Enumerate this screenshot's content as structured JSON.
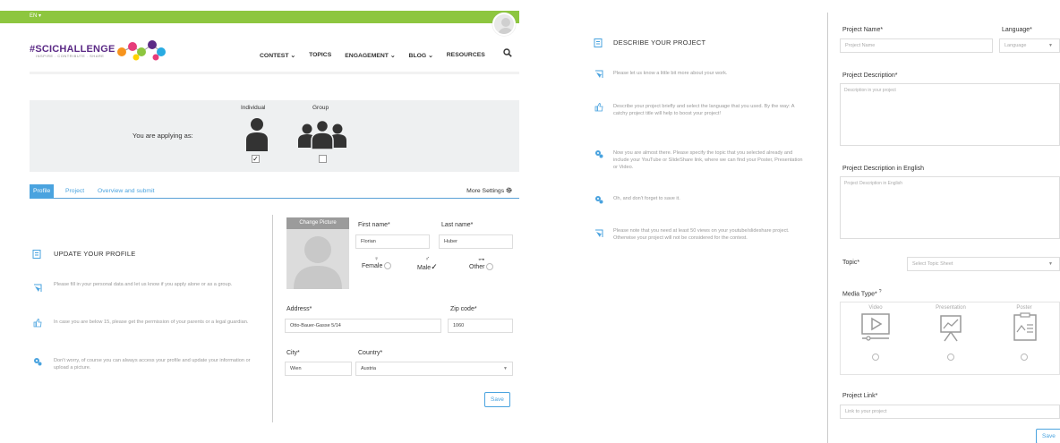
{
  "header": {
    "language": "EN ▾",
    "logo_text": "#SCICHALLENGE",
    "logo_tagline": "INSPIRE . CONTRIBUTE . SHARE",
    "nav": [
      "CONTEST ⌄",
      "TOPICS",
      "ENGAGEMENT ⌄",
      "BLOG ⌄",
      "RESOURCES"
    ]
  },
  "apply": {
    "label": "You are applying as:",
    "individual": "Individual",
    "group": "Group",
    "individual_checked": "✓",
    "group_checked": ""
  },
  "tabs": {
    "profile": "Profile",
    "project": "Project",
    "overview": "Overview and submit",
    "more_settings": "More Settings"
  },
  "left_steps": {
    "title": "UPDATE YOUR PROFILE",
    "items": [
      "Please fill in your personal data and let us know if you apply alone or as a group.",
      "In case you are below 15, please get the permission of your parents or a legal guardian.",
      "Don't worry, of course you can always access your profile and update your information or upload a picture."
    ]
  },
  "profile_form": {
    "change_picture": "Change Picture",
    "first_name_label": "First name*",
    "first_name": "Florian",
    "last_name_label": "Last name*",
    "last_name": "Huber",
    "gender_female": "Female",
    "gender_male": "Male",
    "gender_other": "Other",
    "gender_female_sym": "♀",
    "gender_male_sym": "♂",
    "gender_other_sym": "⊶",
    "male_checked": "✓",
    "address_label": "Address*",
    "address": "Otto-Bauer-Gasse 5/14",
    "zip_label": "Zip code*",
    "zip": "1060",
    "city_label": "City*",
    "city": "Wien",
    "country_label": "Country*",
    "country": "Austria",
    "save": "Save"
  },
  "right_steps": {
    "title": "DESCRIBE YOUR PROJECT",
    "items": [
      "Please let us know a little bit more about your work.",
      "Describe your project briefly and select the language that you used. By the way: A catchy project title will help to boost your project!",
      "Now you are almost there. Please specify the topic that you selected already and include your YouTube or SlideShare link, where we can find your Poster, Presentation or Video.",
      "Oh, and don't forget to save it.",
      "Please note that you need at least 50 views on your youtube/slideshare project. Otherwise your project will not be considered for the contest."
    ]
  },
  "project_form": {
    "name_label": "Project Name*",
    "name_placeholder": "Project Name",
    "language_label": "Language*",
    "language_placeholder": "Language",
    "desc_label": "Project Description*",
    "desc_placeholder": "Description in your project",
    "desc_en_label": "Project Description in English",
    "desc_en_placeholder": "Project Description in English",
    "topic_label": "Topic*",
    "topic_placeholder": "Select Topic Sheet",
    "media_label": "Media Type*",
    "media_help": "?",
    "media_options": [
      "Video",
      "Presentation",
      "Poster"
    ],
    "link_label": "Project Link*",
    "link_placeholder": "Link to your project",
    "save": "Save"
  }
}
